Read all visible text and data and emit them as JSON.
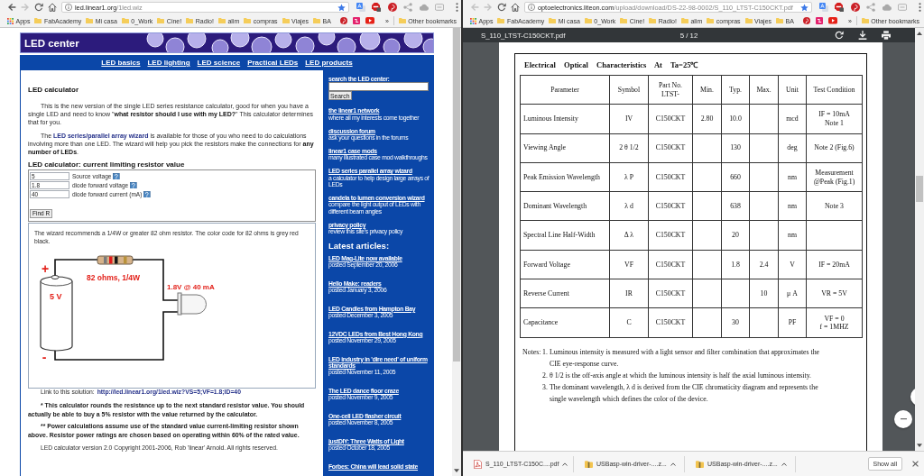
{
  "left_window": {
    "toolbar": {
      "back_disabled": false,
      "forward_disabled": true,
      "address_host": "led.linear1.org",
      "address_path": "/1led.wiz",
      "starred": true
    },
    "bookmarks": {
      "items": [
        {
          "label": "Apps",
          "kind": "apps"
        },
        {
          "label": "FabAcademy",
          "kind": "folder"
        },
        {
          "label": "Mi casa",
          "kind": "folder"
        },
        {
          "label": "0_Work",
          "kind": "folder"
        },
        {
          "label": "Cine!",
          "kind": "folder"
        },
        {
          "label": "Radio!",
          "kind": "folder"
        },
        {
          "label": "alim",
          "kind": "folder"
        },
        {
          "label": "compras",
          "kind": "folder"
        },
        {
          "label": "Viajes",
          "kind": "folder"
        },
        {
          "label": "BA",
          "kind": "folder"
        }
      ],
      "overflow": "»",
      "other": "Other bookmarks"
    },
    "page": {
      "banner_title": "LED center",
      "nav_links": [
        "LED basics",
        "LED lighting",
        "LED science",
        "Practical LEDs",
        "LED products"
      ],
      "calculator": {
        "title": "LED calculator",
        "intro": "This is the new version of the single LED series resistance calculator, good for when you have a single LED and need to know \"**what resistor should I use with my LED?**\" This calculator determines that for you.",
        "wizard_note": {
          "before": "The ",
          "link": "LED series/parallel array wizard",
          "after": " is available for those of you who need to do calculations involving more than one LED. The wizard will help you pick the resistors make the connections for **any number of LEDs**."
        },
        "form_title": "LED calculator: current limiting resistor value",
        "fields": [
          {
            "value": "5",
            "label": "Source voltage"
          },
          {
            "value": "1.8",
            "label": "diode forward voltage"
          },
          {
            "value": "40",
            "label": "diode forward current (mA)"
          }
        ],
        "submit": "Find R",
        "result": {
          "text": "The wizard recommends a 1/4W or greater 82 ohm resistor. The color code for 82 ohms is grey red black.",
          "circuit": {
            "plus": "+",
            "battery": "5 V",
            "minus": "-",
            "resistor": "82 ohms, 1/4W",
            "led": "1.8V @ 40 mA"
          }
        },
        "solution_link": {
          "label": "Link to this solution:",
          "url": "http://led.linear1.org/1led.wiz?VS=5;VF=1.8;ID=40"
        },
        "footnotes": [
          "* This calculator rounds the resistance up to the next standard resistor value. You should actually be able to buy a 5% resistor with the value returned by the calculator.",
          "** Power calculations assume use of the standard value current-limiting resistor shown above. Resistor power ratings are chosen based on operating within 60% of the rated value."
        ],
        "copyright": "LED calculator version 2.0 Copyright 2001-2006, Rob 'linear' Arnold. All rights reserved."
      },
      "sidebar": {
        "search_label": "search the LED center:",
        "search_button": "Search",
        "links": [
          {
            "title": "the linear1 network",
            "description": "where all my interests come together"
          },
          {
            "title": "discussion forum",
            "description": "ask your questions in the forums"
          },
          {
            "title": "linear1 case mods",
            "description": "many illustrated case mod walkthroughs"
          },
          {
            "title": "LED series parallel array wizard",
            "description": "a calculator to help design large arrays of LEDs"
          },
          {
            "title": "candela to lumen conversion wizard",
            "description": "compare the light output of LEDs with different beam angles"
          },
          {
            "title": "privacy policy",
            "description": "review this site's privacy policy"
          }
        ],
        "articles_heading": "Latest articles:",
        "articles": [
          {
            "title": "LED Mag-Lite now available",
            "date": "posted September 20, 2006"
          },
          {
            "title": "Hello Make: readers",
            "date": "posted January 3, 2006"
          },
          {
            "title": "LED Candles from Hampton Bay",
            "date": "posted December 3, 2005"
          },
          {
            "title": "12VDC LEDs from Best Hong Kong",
            "date": "posted November 29, 2005"
          },
          {
            "title": "LED industry in 'dire need' of uniform standards",
            "date": "posted November 11, 2005"
          },
          {
            "title": "The LED dance floor craze",
            "date": "posted November 9, 2005"
          },
          {
            "title": "One-cell LED flasher circuit",
            "date": "posted November 8, 2005"
          },
          {
            "title": "justDIY: Three Watts of Light",
            "date": "posted October 18, 2005"
          },
          {
            "title": "Forbes: China will lead solid state"
          }
        ]
      }
    }
  },
  "right_window": {
    "toolbar": {
      "back_disabled": true,
      "forward_disabled": true,
      "address_host": "optoelectronics.liteon.com",
      "address_path": "/upload/download/DS-22-98-0002/S_110_LTST-C150CKT.pdf",
      "starred": true
    },
    "bookmarks": {
      "items": [
        {
          "label": "Apps",
          "kind": "apps"
        },
        {
          "label": "FabAcademy",
          "kind": "folder"
        },
        {
          "label": "Mi casa",
          "kind": "folder"
        },
        {
          "label": "0_Work",
          "kind": "folder"
        },
        {
          "label": "Cine!",
          "kind": "folder"
        },
        {
          "label": "Radio!",
          "kind": "folder"
        },
        {
          "label": "alim",
          "kind": "folder"
        },
        {
          "label": "compras",
          "kind": "folder"
        },
        {
          "label": "Viajes",
          "kind": "folder"
        },
        {
          "label": "BA",
          "kind": "folder"
        }
      ],
      "overflow": "»",
      "other": "Other bookmarks"
    },
    "pdf_viewer": {
      "filename": "S_110_LTST-C150CKT.pdf",
      "page_label": "5 / 12",
      "document": {
        "heading": "Electrical Optical Characteristics At Ta=25℃",
        "table": {
          "columns": [
            "Parameter",
            "Symbol",
            "Part No. LTST-",
            "Min.",
            "Typ.",
            "Max.",
            "Unit",
            "Test Condition"
          ],
          "rows": [
            [
              "Luminous Intensity",
              "IV",
              "C150CKT",
              "2.80",
              "10.0",
              null,
              "mcd",
              "IF = 10mA\nNote 1"
            ],
            [
              "Viewing Angle",
              "2 θ 1/2",
              "C150CKT",
              null,
              "130",
              null,
              "deg",
              "Note 2 (Fig.6)"
            ],
            [
              "Peak Emission Wavelength",
              "λ P",
              "C150CKT",
              null,
              "660",
              null,
              "nm",
              "Measurement\n@Peak (Fig.1)"
            ],
            [
              "Dominant Wavelength",
              "λ d",
              "C150CKT",
              null,
              "638",
              null,
              "nm",
              "Note 3"
            ],
            [
              "Spectral Line Half-Width",
              "Δ λ",
              "C150CKT",
              null,
              "20",
              null,
              "nm",
              null
            ],
            [
              "Forward Voltage",
              "VF",
              "C150CKT",
              null,
              "1.8",
              "2.4",
              "V",
              "IF = 20mA"
            ],
            [
              "Reverse Current",
              "IR",
              "C150CKT",
              null,
              null,
              "10",
              "μ A",
              "VR = 5V"
            ],
            [
              "Capacitance",
              "C",
              "C150CKT",
              null,
              "30",
              null,
              "PF",
              "VF = 0\nf = 1MHZ"
            ]
          ]
        },
        "notes_label": "Notes:",
        "notes": [
          {
            "number": "1.",
            "text": "Luminous intensity is measured with a light sensor and filter combination that approximates the CIE eye-response curve."
          },
          {
            "number": "2.",
            "text": "θ 1/2 is the off-axis angle at which the luminous intensity is half the axial luminous intensity."
          },
          {
            "number": "3.",
            "text": "The dominant wavelength,  λ d is derived from the CIE chromaticity diagram and represents the single wavelength which defines the color of the device."
          }
        ]
      }
    },
    "downloads": {
      "items": [
        {
          "filename": "S_110_LTST-C150C....pdf",
          "kind": "pdf"
        },
        {
          "filename": "USBasp-win-driver-....z...",
          "kind": "zip"
        },
        {
          "filename": "USBasp-win-driver-....z...",
          "kind": "zip"
        }
      ],
      "show_all": "Show all"
    }
  }
}
